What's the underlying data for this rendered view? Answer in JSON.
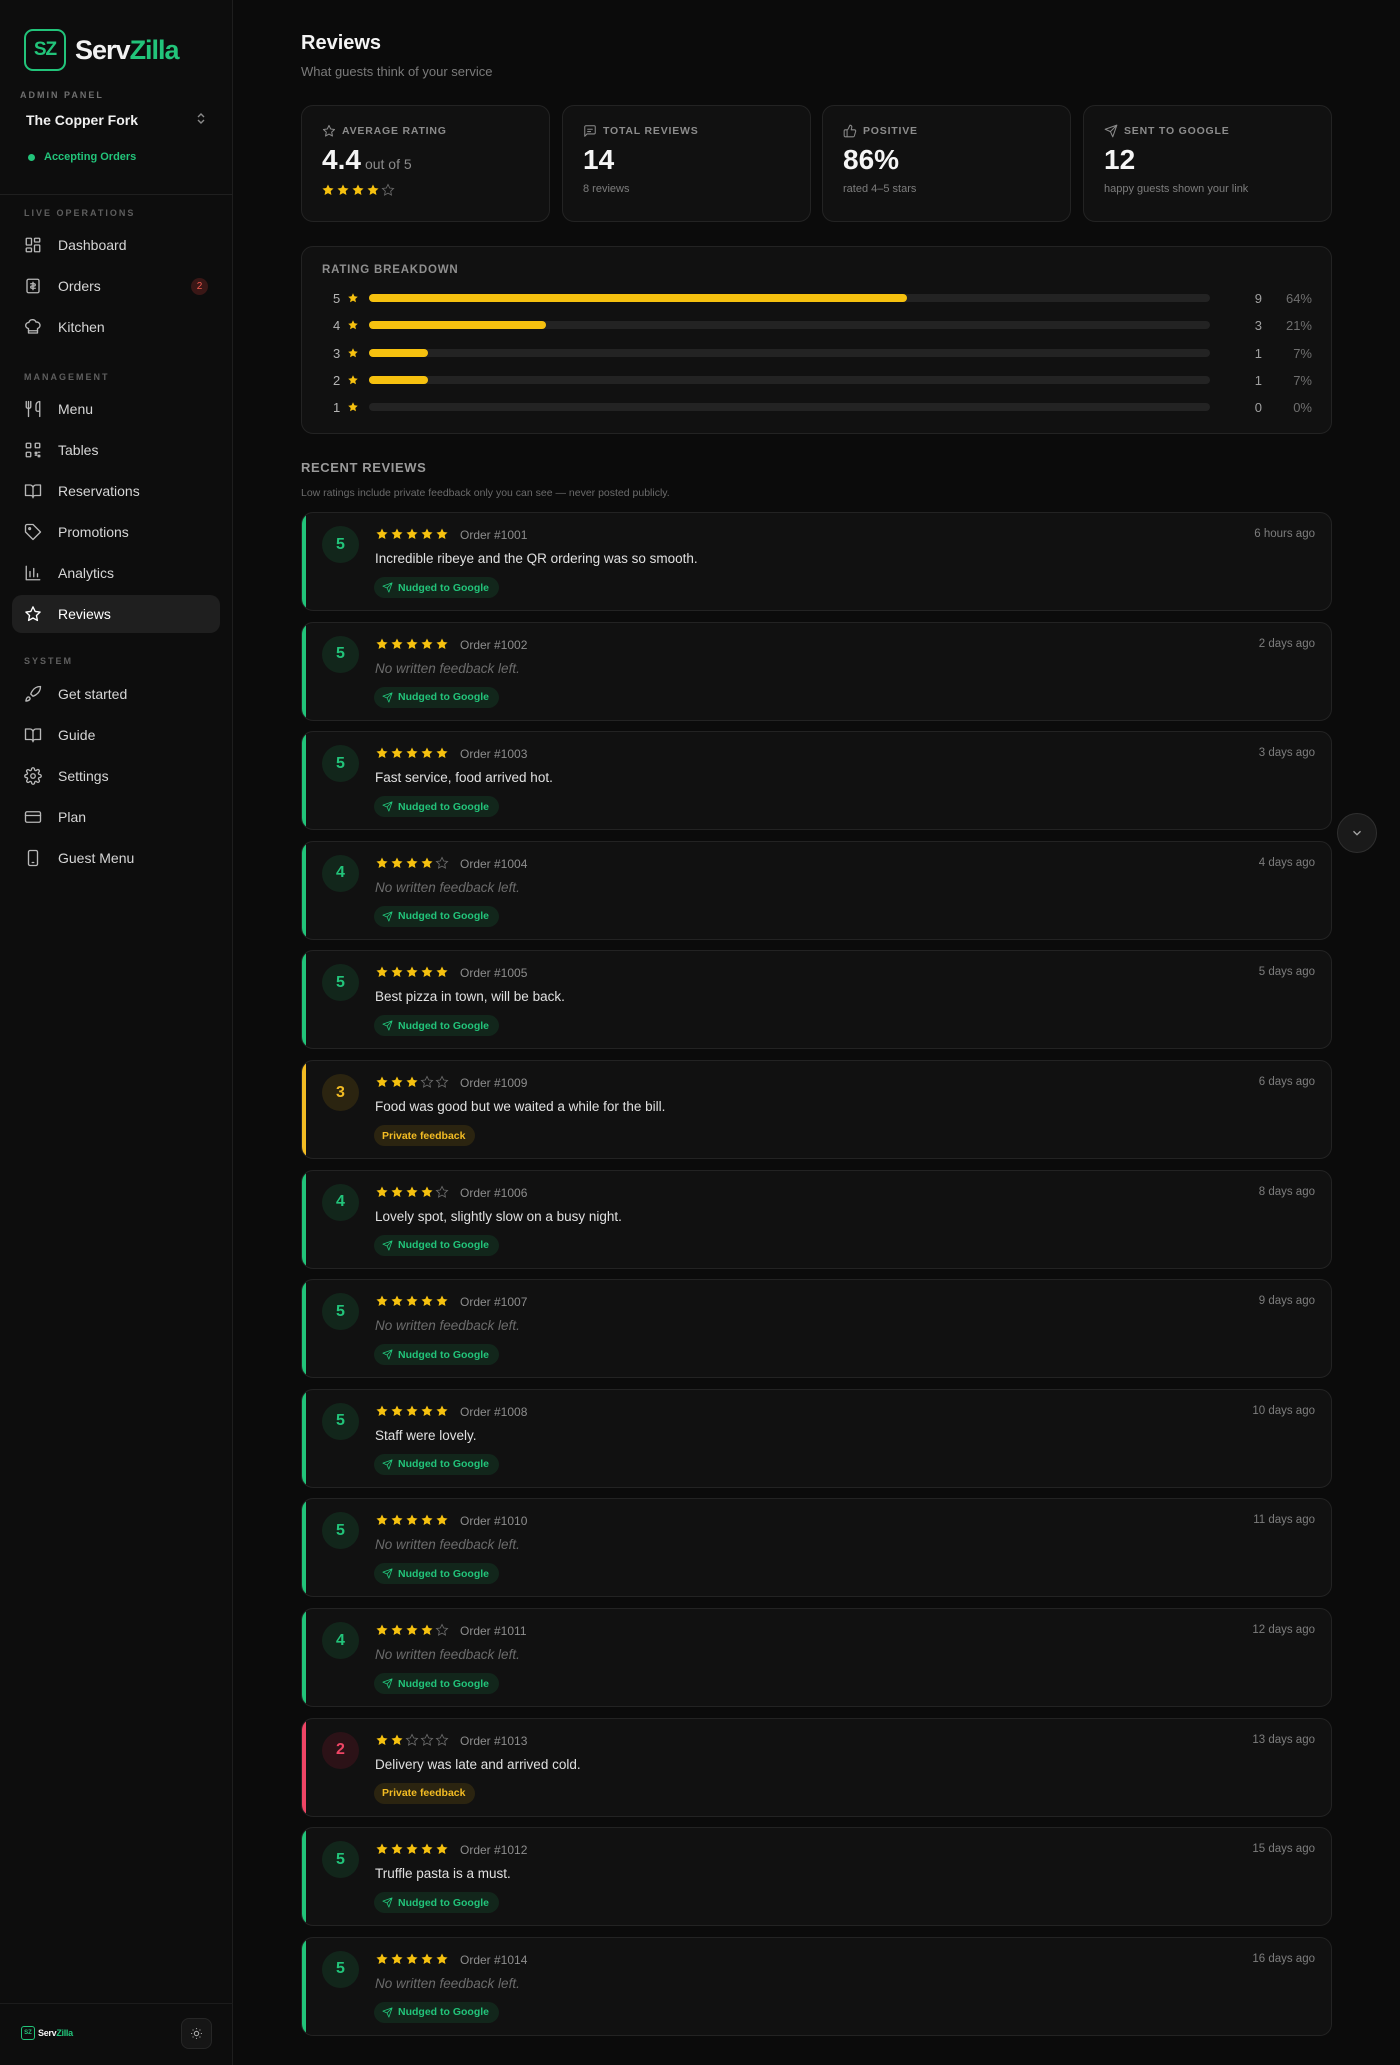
{
  "brand": {
    "mark": "SZ",
    "name_a": "Serv",
    "name_b": "Zilla",
    "accent": "#22c47a"
  },
  "sidebar": {
    "admin_label": "ADMIN PANEL",
    "restaurant": "The Copper Fork",
    "status": "Accepting Orders",
    "sections": {
      "live": "LIVE OPERATIONS",
      "management": "MANAGEMENT",
      "system": "SYSTEM"
    },
    "items": [
      {
        "label": "Dashboard",
        "icon": "dashboard-icon"
      },
      {
        "label": "Orders",
        "icon": "orders-icon",
        "badge": "2"
      },
      {
        "label": "Kitchen",
        "icon": "chef-hat-icon"
      },
      {
        "label": "Menu",
        "icon": "utensils-icon"
      },
      {
        "label": "Tables",
        "icon": "qr-code-icon"
      },
      {
        "label": "Reservations",
        "icon": "book-open-icon"
      },
      {
        "label": "Promotions",
        "icon": "tag-icon"
      },
      {
        "label": "Analytics",
        "icon": "bar-chart-icon"
      },
      {
        "label": "Reviews",
        "icon": "star-icon",
        "active": true
      },
      {
        "label": "Get started",
        "icon": "rocket-icon"
      },
      {
        "label": "Guide",
        "icon": "book-icon"
      },
      {
        "label": "Settings",
        "icon": "gear-icon"
      },
      {
        "label": "Plan",
        "icon": "credit-card-icon"
      },
      {
        "label": "Guest Menu",
        "icon": "phone-icon"
      }
    ]
  },
  "header": {
    "title": "Reviews",
    "subtitle": "What guests think of your service"
  },
  "stats": [
    {
      "label": "AVERAGE RATING",
      "value": "4.4",
      "suffix": "out of 5",
      "stars": 4,
      "icon": "star-outline-icon"
    },
    {
      "label": "TOTAL REVIEWS",
      "value": "14",
      "sub": "8 reviews",
      "icon": "message-icon"
    },
    {
      "label": "POSITIVE",
      "value": "86%",
      "sub": "rated 4–5 stars",
      "icon": "thumbs-up-icon"
    },
    {
      "label": "SENT TO GOOGLE",
      "value": "12",
      "sub": "happy guests shown your link",
      "icon": "send-icon"
    }
  ],
  "breakdown": {
    "title": "RATING BREAKDOWN",
    "rows": [
      {
        "stars": "5",
        "count": "9",
        "pct": "64%",
        "fraction": 0.64
      },
      {
        "stars": "4",
        "count": "3",
        "pct": "21%",
        "fraction": 0.21
      },
      {
        "stars": "3",
        "count": "1",
        "pct": "7%",
        "fraction": 0.07
      },
      {
        "stars": "2",
        "count": "1",
        "pct": "7%",
        "fraction": 0.07
      },
      {
        "stars": "1",
        "count": "0",
        "pct": "0%",
        "fraction": 0.0
      }
    ]
  },
  "recent": {
    "title": "RECENT REVIEWS",
    "note": "Low ratings include private feedback only you can see — never posted publicly.",
    "tag_google": "Nudged to Google",
    "tag_private": "Private feedback",
    "reviews": [
      {
        "rating": 5,
        "order": "Order #1001",
        "time": "6 hours ago",
        "text": "Incredible ribeye and the QR ordering was so smooth.",
        "tag": "google"
      },
      {
        "rating": 5,
        "order": "Order #1002",
        "time": "2 days ago",
        "text": "No written feedback left.",
        "empty": true,
        "tag": "google"
      },
      {
        "rating": 5,
        "order": "Order #1003",
        "time": "3 days ago",
        "text": "Fast service, food arrived hot.",
        "tag": "google"
      },
      {
        "rating": 4,
        "order": "Order #1004",
        "time": "4 days ago",
        "text": "No written feedback left.",
        "empty": true,
        "tag": "google"
      },
      {
        "rating": 5,
        "order": "Order #1005",
        "time": "5 days ago",
        "text": "Best pizza in town, will be back.",
        "tag": "google"
      },
      {
        "rating": 3,
        "order": "Order #1009",
        "time": "6 days ago",
        "text": "Food was good but we waited a while for the bill.",
        "tag": "private"
      },
      {
        "rating": 4,
        "order": "Order #1006",
        "time": "8 days ago",
        "text": "Lovely spot, slightly slow on a busy night.",
        "tag": "google"
      },
      {
        "rating": 5,
        "order": "Order #1007",
        "time": "9 days ago",
        "text": "No written feedback left.",
        "empty": true,
        "tag": "google"
      },
      {
        "rating": 5,
        "order": "Order #1008",
        "time": "10 days ago",
        "text": "Staff were lovely.",
        "tag": "google"
      },
      {
        "rating": 5,
        "order": "Order #1010",
        "time": "11 days ago",
        "text": "No written feedback left.",
        "empty": true,
        "tag": "google"
      },
      {
        "rating": 4,
        "order": "Order #1011",
        "time": "12 days ago",
        "text": "No written feedback left.",
        "empty": true,
        "tag": "google"
      },
      {
        "rating": 2,
        "order": "Order #1013",
        "time": "13 days ago",
        "text": "Delivery was late and arrived cold.",
        "tag": "private"
      },
      {
        "rating": 5,
        "order": "Order #1012",
        "time": "15 days ago",
        "text": "Truffle pasta is a must.",
        "tag": "google"
      },
      {
        "rating": 5,
        "order": "Order #1014",
        "time": "16 days ago",
        "text": "No written feedback left.",
        "empty": true,
        "tag": "google"
      }
    ]
  },
  "colors": {
    "star": "#f6c10f",
    "positive": "#22c47a",
    "neutral": "#f3bc23",
    "negative": "#ef4565"
  }
}
